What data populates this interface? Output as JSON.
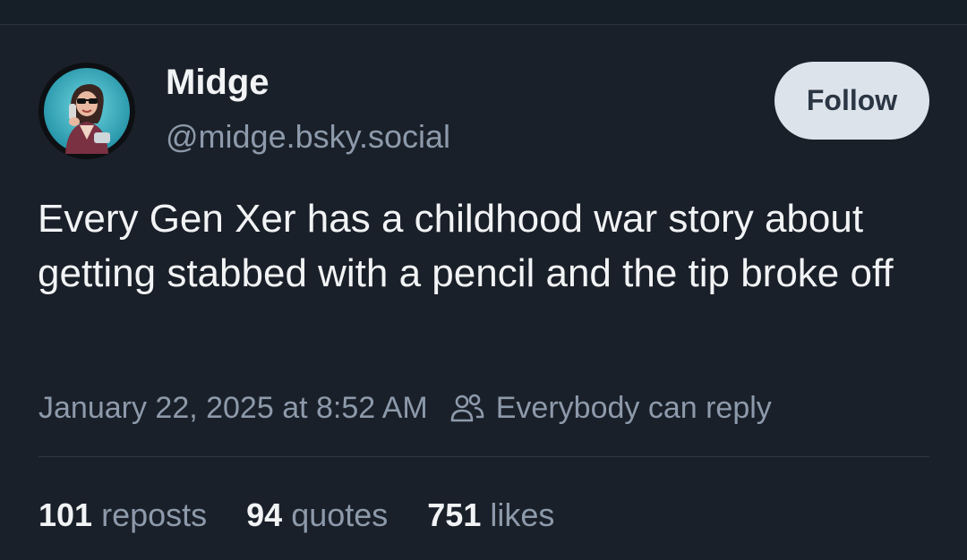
{
  "author": {
    "display_name": "Midge",
    "handle": "@midge.bsky.social"
  },
  "follow_button": {
    "label": "Follow"
  },
  "post": {
    "text": "Every Gen Xer has a childhood war story about getting stabbed with a pencil and the tip broke off",
    "timestamp": "January 22, 2025 at 8:52 AM",
    "reply_setting": "Everybody can reply",
    "reply_setting_icon": "people-icon"
  },
  "stats": [
    {
      "count": "101",
      "label": "reposts"
    },
    {
      "count": "94",
      "label": "quotes"
    },
    {
      "count": "751",
      "label": "likes"
    }
  ],
  "colors": {
    "background": "#1a2029",
    "text_primary": "#f1f3f5",
    "text_secondary": "#8d9aab",
    "follow_button_bg": "#dde3ea"
  }
}
